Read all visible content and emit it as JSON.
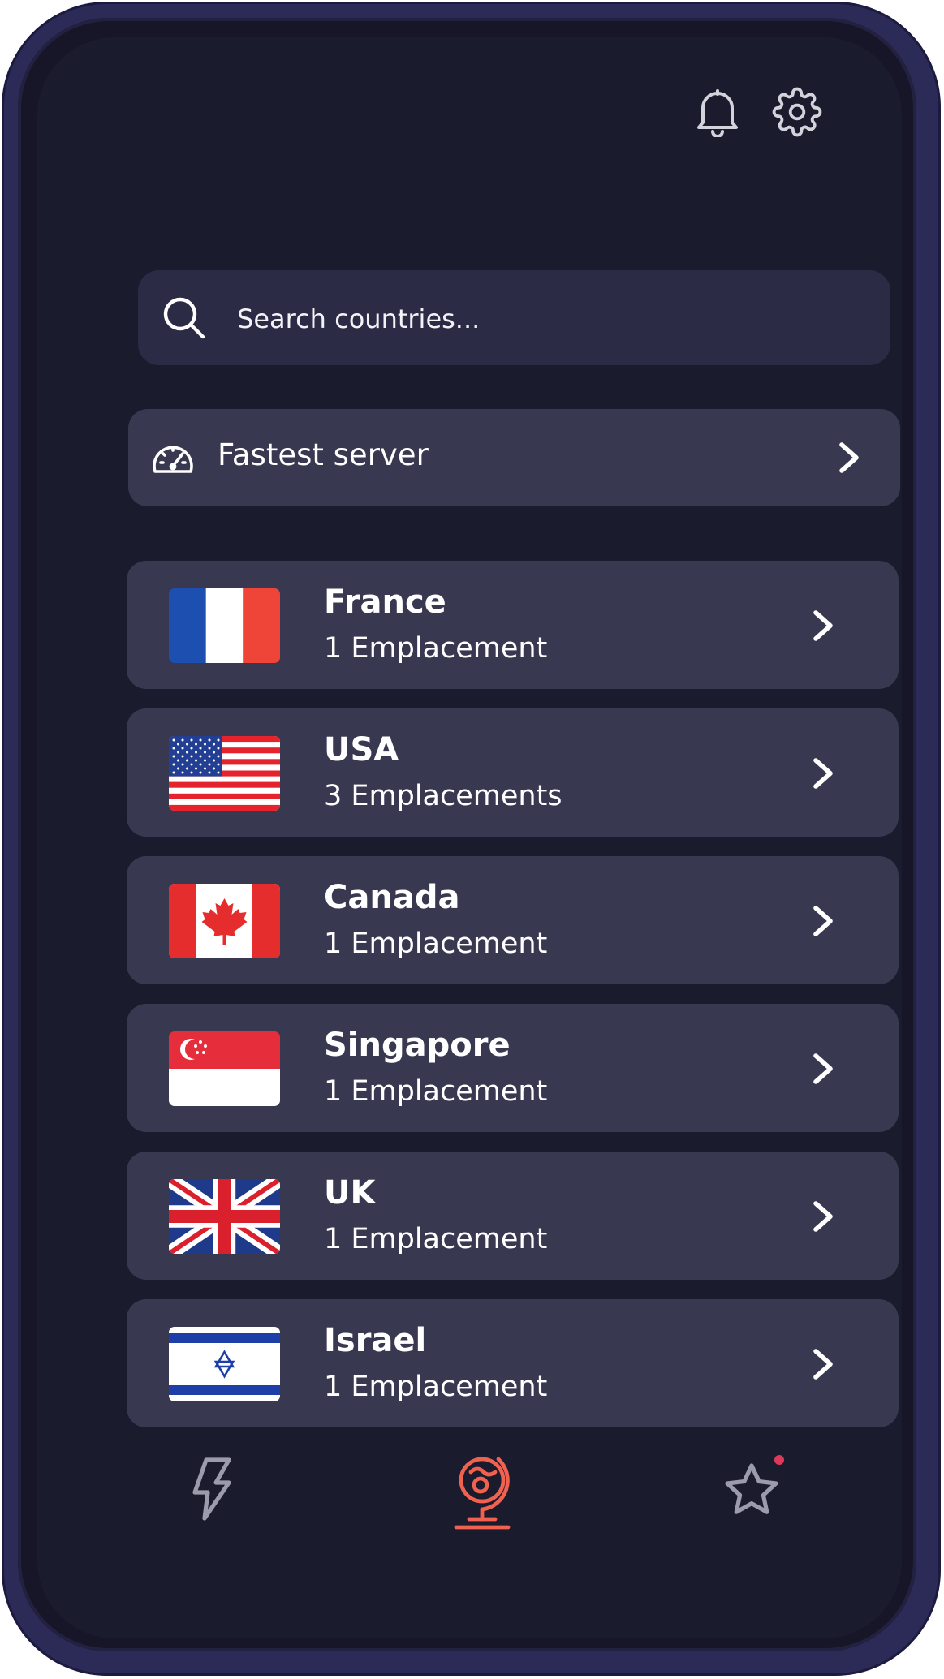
{
  "search": {
    "placeholder": "Search countries..."
  },
  "fastest": {
    "label": "Fastest server"
  },
  "countries": [
    {
      "name": "France",
      "count": "1 Emplacement",
      "flag": "france-flag"
    },
    {
      "name": "USA",
      "count": "3 Emplacements",
      "flag": "usa-flag"
    },
    {
      "name": "Canada",
      "count": "1 Emplacement",
      "flag": "canada-flag"
    },
    {
      "name": "Singapore",
      "count": "1 Emplacement",
      "flag": "singapore-flag"
    },
    {
      "name": "UK",
      "count": "1 Emplacement",
      "flag": "uk-flag"
    },
    {
      "name": "Israel",
      "count": "1 Emplacement",
      "flag": "israel-flag"
    }
  ],
  "header_icons": [
    "bell-icon",
    "gear-icon"
  ],
  "nav": {
    "items": [
      "lightning-icon",
      "globe-icon",
      "star-icon"
    ],
    "active": "globe-icon",
    "accent": "#f0614f",
    "notification_dot": "#e0385a"
  },
  "colors": {
    "background": "#1b1b2e",
    "card": "#383850",
    "search": "#2b2b46",
    "frame": "#2c2a57"
  }
}
